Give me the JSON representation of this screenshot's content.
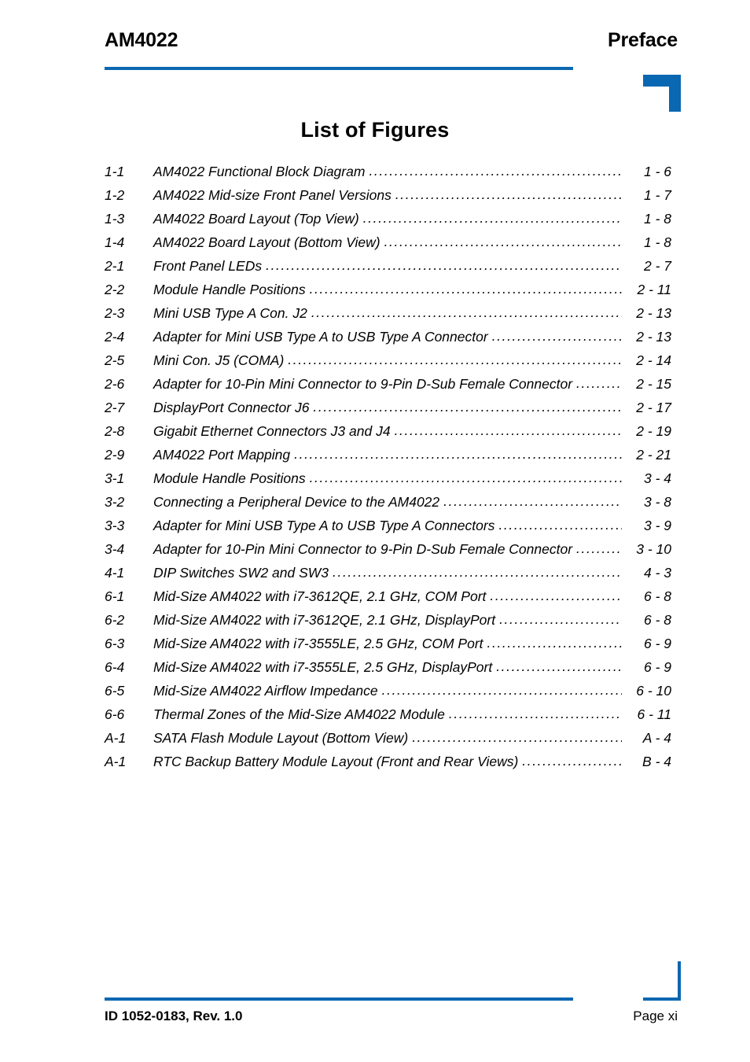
{
  "header": {
    "document_name": "AM4022",
    "section_name": "Preface",
    "accent_color": "#0a67b1"
  },
  "title": "List of Figures",
  "figures": [
    {
      "number": "1-1",
      "title": "AM4022 Functional Block Diagram",
      "page": "1 - 6"
    },
    {
      "number": "1-2",
      "title": "AM4022 Mid-size Front Panel Versions",
      "page": "1 - 7"
    },
    {
      "number": "1-3",
      "title": "AM4022 Board Layout (Top View)",
      "page": "1 - 8"
    },
    {
      "number": "1-4",
      "title": "AM4022 Board Layout (Bottom View)",
      "page": "1 - 8"
    },
    {
      "number": "2-1",
      "title": "Front Panel LEDs",
      "page": "2 - 7"
    },
    {
      "number": "2-2",
      "title": "Module Handle Positions  ",
      "page": "2 - 11"
    },
    {
      "number": "2-3",
      "title": "Mini USB Type A Con. J2",
      "page": "2 - 13"
    },
    {
      "number": "2-4",
      "title": "Adapter for Mini USB Type A to USB Type A Connector",
      "page": "2 - 13"
    },
    {
      "number": "2-5",
      "title": "Mini Con. J5 (COMA)",
      "page": "2 - 14"
    },
    {
      "number": "2-6",
      "title": "Adapter for 10-Pin Mini Connector to 9-Pin D-Sub Female Connector",
      "page": "2 - 15"
    },
    {
      "number": "2-7",
      "title": "DisplayPort Connector J6",
      "page": "2 - 17"
    },
    {
      "number": "2-8",
      "title": "Gigabit Ethernet Connectors J3 and J4",
      "page": "2 - 19"
    },
    {
      "number": "2-9",
      "title": "AM4022 Port Mapping",
      "page": "2 - 21"
    },
    {
      "number": "3-1",
      "title": "Module Handle Positions",
      "page": "3 - 4"
    },
    {
      "number": "3-2",
      "title": "Connecting a Peripheral Device to the AM4022",
      "page": "3 - 8"
    },
    {
      "number": "3-3",
      "title": "Adapter for Mini USB Type A to USB Type A Connectors",
      "page": "3 - 9"
    },
    {
      "number": "3-4",
      "title": "Adapter for 10-Pin Mini Connector to 9-Pin D-Sub Female Connector",
      "page": "3 - 10"
    },
    {
      "number": "4-1",
      "title": "DIP Switches SW2 and SW3",
      "page": "4 - 3"
    },
    {
      "number": "6-1",
      "title": "Mid-Size AM4022 with i7-3612QE, 2.1 GHz, COM Port",
      "page": "6 - 8"
    },
    {
      "number": "6-2",
      "title": "Mid-Size AM4022 with i7-3612QE, 2.1 GHz, DisplayPort",
      "page": "6 - 8"
    },
    {
      "number": "6-3",
      "title": "Mid-Size AM4022 with i7-3555LE, 2.5 GHz, COM Port",
      "page": "6 - 9"
    },
    {
      "number": "6-4",
      "title": "Mid-Size AM4022 with i7-3555LE, 2.5 GHz, DisplayPort",
      "page": "6 - 9"
    },
    {
      "number": "6-5",
      "title": "Mid-Size AM4022 Airflow Impedance",
      "page": "6 - 10"
    },
    {
      "number": "6-6",
      "title": "Thermal Zones of the Mid-Size AM4022 Module",
      "page": "6 - 11"
    },
    {
      "number": "A-1",
      "title": "SATA Flash Module Layout (Bottom View)",
      "page": "A - 4"
    },
    {
      "number": "A-1",
      "title": "RTC Backup Battery Module Layout (Front and Rear Views)",
      "page": "B - 4"
    }
  ],
  "footer": {
    "document_id": "ID 1052-0183, Rev. 1.0",
    "page_label": "Page xi"
  }
}
